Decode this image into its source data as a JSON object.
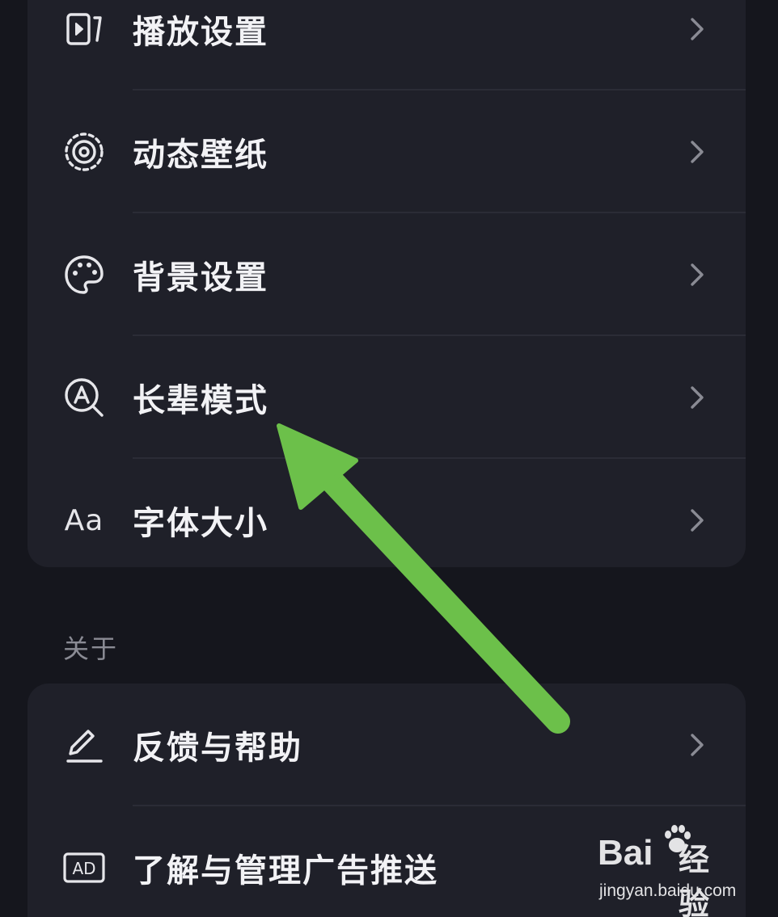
{
  "settings_group": {
    "items": [
      {
        "label": "播放设置",
        "icon": "video-play-icon"
      },
      {
        "label": "动态壁纸",
        "icon": "live-wallpaper-icon"
      },
      {
        "label": "背景设置",
        "icon": "palette-icon"
      },
      {
        "label": "长辈模式",
        "icon": "elder-mode-icon"
      },
      {
        "label": "字体大小",
        "icon": "font-size-icon",
        "icon_text": "Aa"
      }
    ]
  },
  "about_section": {
    "title": "关于",
    "items": [
      {
        "label": "反馈与帮助",
        "icon": "pencil-icon"
      },
      {
        "label": "了解与管理广告推送",
        "icon": "ad-icon",
        "icon_text": "AD"
      }
    ]
  },
  "annotation": {
    "arrow_color": "#6cc04a",
    "points_to": "长辈模式"
  },
  "watermark": {
    "brand": "Bai",
    "brand_suffix": "经验",
    "url": "jingyan.baidu.com"
  },
  "colors": {
    "background": "#15161d",
    "card": "#1f2029",
    "text": "#f2f2f5",
    "section_title": "#8a8b94",
    "chevron": "#8a8b94"
  }
}
